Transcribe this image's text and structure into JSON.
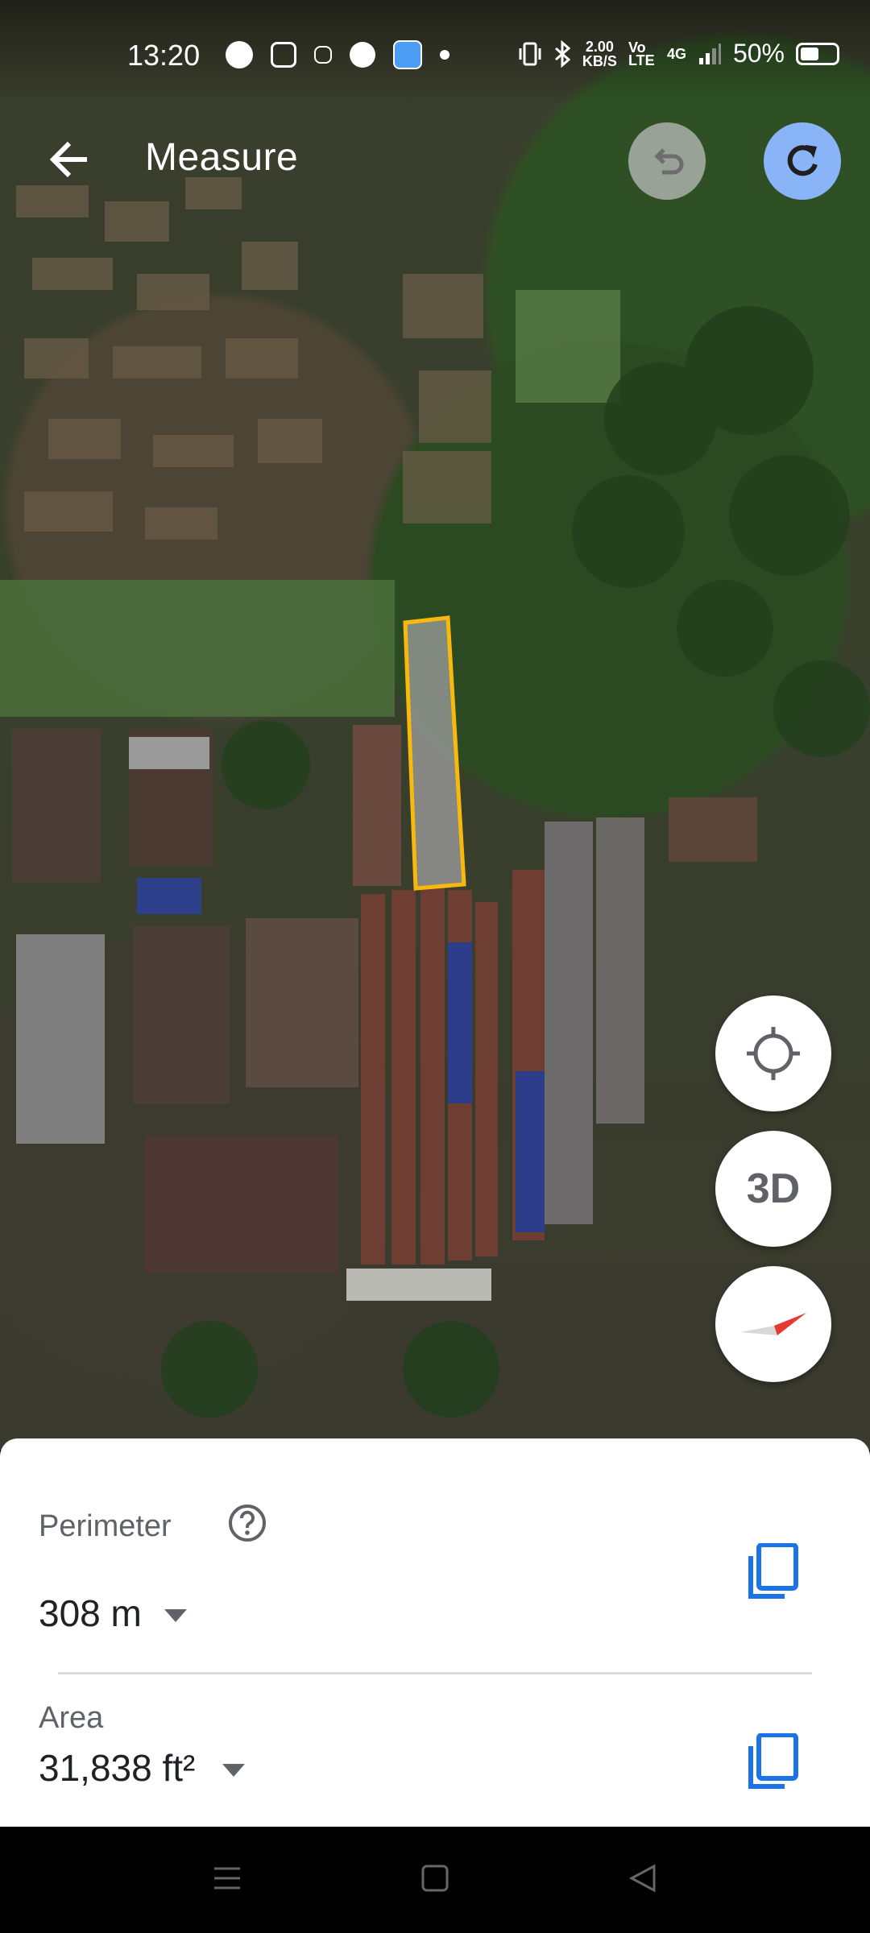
{
  "status_bar": {
    "time": "13:20",
    "speed_value": "2.00",
    "speed_unit": "KB/S",
    "volte": "Vo LTE",
    "network": "4G",
    "battery_pct": "50%",
    "battery_level": 0.5
  },
  "header": {
    "title": "Measure",
    "back_icon": "arrow-back-icon",
    "undo_icon": "undo-icon",
    "redo_icon": "redo-icon"
  },
  "map_controls": {
    "my_location_icon": "crosshair-icon",
    "three_d_label": "3D",
    "compass_icon": "compass-icon"
  },
  "measurement": {
    "perimeter_label": "Perimeter",
    "perimeter_value": "308 m",
    "area_label": "Area",
    "area_value": "31,838 ft²",
    "shape_color": "#f9b90c",
    "accent_color": "#1a73e8"
  },
  "nav_bar": {
    "icons": [
      "menu-icon",
      "home-icon",
      "back-triangle-icon"
    ]
  }
}
